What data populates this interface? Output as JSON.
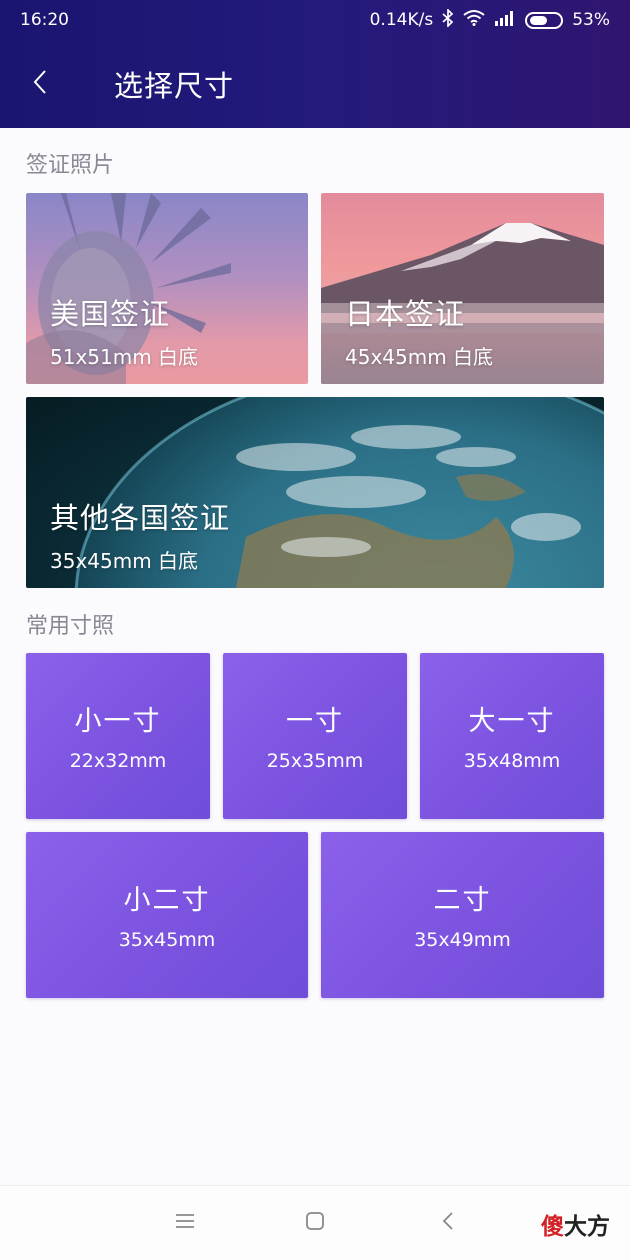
{
  "status_bar": {
    "time": "16:20",
    "net_speed": "0.14K/s",
    "battery": "53%"
  },
  "app_bar": {
    "title": "选择尺寸",
    "back_icon": "chevron-left-icon"
  },
  "visa_section": {
    "title": "签证照片",
    "cards": [
      {
        "name": "美国签证",
        "spec": "51x51mm 白底"
      },
      {
        "name": "日本签证",
        "spec": "45x45mm 白底"
      },
      {
        "name": "其他各国签证",
        "spec": "35x45mm 白底"
      }
    ]
  },
  "common_section": {
    "title": "常用寸照",
    "sizes": [
      {
        "name": "小一寸",
        "mm": "22x32mm"
      },
      {
        "name": "一寸",
        "mm": "25x35mm"
      },
      {
        "name": "大一寸",
        "mm": "35x48mm"
      },
      {
        "name": "小二寸",
        "mm": "35x45mm"
      },
      {
        "name": "二寸",
        "mm": "35x49mm"
      }
    ]
  },
  "nav_bar": {
    "icons": [
      "menu-icon",
      "home-square-icon",
      "back-chevron-icon"
    ],
    "watermark_red": "傻",
    "watermark_dark": "大方"
  },
  "colors": {
    "header": "#231a7c",
    "size_card": "#7a52df",
    "page_bg": "#fbfafc"
  }
}
